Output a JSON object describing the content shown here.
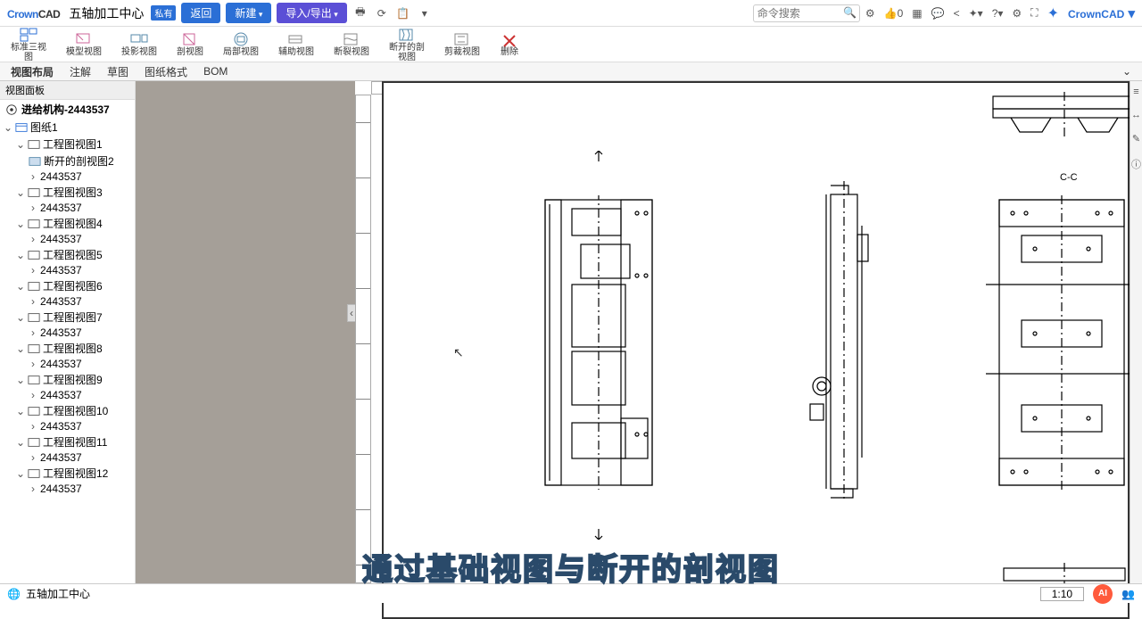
{
  "app": {
    "logo_a": "Crown",
    "logo_b": "CAD",
    "doc": "五轴加工中心",
    "badge": "私有",
    "back": "返回",
    "new": "新建",
    "io": "导入/导出",
    "brand": "CrownCAD"
  },
  "search": {
    "placeholder": "命令搜索"
  },
  "likes": "0",
  "ribbon": [
    {
      "k": "std",
      "l1": "标准三视",
      "l2": "图"
    },
    {
      "k": "model",
      "l1": "模型视图",
      "l2": ""
    },
    {
      "k": "proj",
      "l1": "投影视图",
      "l2": ""
    },
    {
      "k": "sect",
      "l1": "剖视图",
      "l2": ""
    },
    {
      "k": "local",
      "l1": "局部视图",
      "l2": ""
    },
    {
      "k": "aux",
      "l1": "辅助视图",
      "l2": ""
    },
    {
      "k": "crop",
      "l1": "断裂视图",
      "l2": ""
    },
    {
      "k": "broken",
      "l1": "断开的剖",
      "l2": "视图"
    },
    {
      "k": "clip",
      "l1": "剪裁视图",
      "l2": ""
    },
    {
      "k": "del",
      "l1": "删除",
      "l2": ""
    }
  ],
  "tabs": [
    "视图布局",
    "注解",
    "草图",
    "图纸格式",
    "BOM"
  ],
  "panel_title": "视图面板",
  "root": "进给机构-2443537",
  "sheet": "图纸1",
  "part": "2443537",
  "views": [
    {
      "name": "工程图视图1",
      "children": [
        "断开的剖视图2",
        "2443537"
      ]
    },
    {
      "name": "工程图视图3",
      "children": [
        "2443537"
      ]
    },
    {
      "name": "工程图视图4",
      "children": [
        "2443537"
      ]
    },
    {
      "name": "工程图视图5",
      "children": [
        "2443537"
      ]
    },
    {
      "name": "工程图视图6",
      "children": [
        "2443537"
      ]
    },
    {
      "name": "工程图视图7",
      "children": [
        "2443537"
      ]
    },
    {
      "name": "工程图视图8",
      "children": [
        "2443537"
      ]
    },
    {
      "name": "工程图视图9",
      "children": [
        "2443537"
      ]
    },
    {
      "name": "工程图视图10",
      "children": [
        "2443537"
      ]
    },
    {
      "name": "工程图视图11",
      "children": [
        "2443537"
      ]
    },
    {
      "name": "工程图视图12",
      "children": [
        "2443537"
      ]
    }
  ],
  "section_label": "C-C",
  "zoom": "1:10",
  "status_doc": "五轴加工中心",
  "subtitle": "通过基础视图与断开的剖视图"
}
